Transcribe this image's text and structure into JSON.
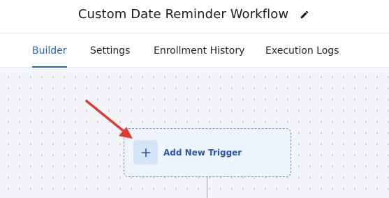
{
  "header": {
    "title": "Custom Date Reminder Workflow",
    "edit_icon": "pencil-icon"
  },
  "tabs": [
    {
      "label": "Builder",
      "active": true
    },
    {
      "label": "Settings",
      "active": false
    },
    {
      "label": "Enrollment History",
      "active": false
    },
    {
      "label": "Execution Logs",
      "active": false
    }
  ],
  "canvas": {
    "trigger": {
      "label": "Add New Trigger",
      "icon": "plus-icon"
    },
    "annotation": {
      "type": "arrow",
      "color": "#e03a34"
    }
  },
  "colors": {
    "accent": "#2563c9",
    "trigger_text": "#2a56b8",
    "annotation": "#e03a34"
  }
}
